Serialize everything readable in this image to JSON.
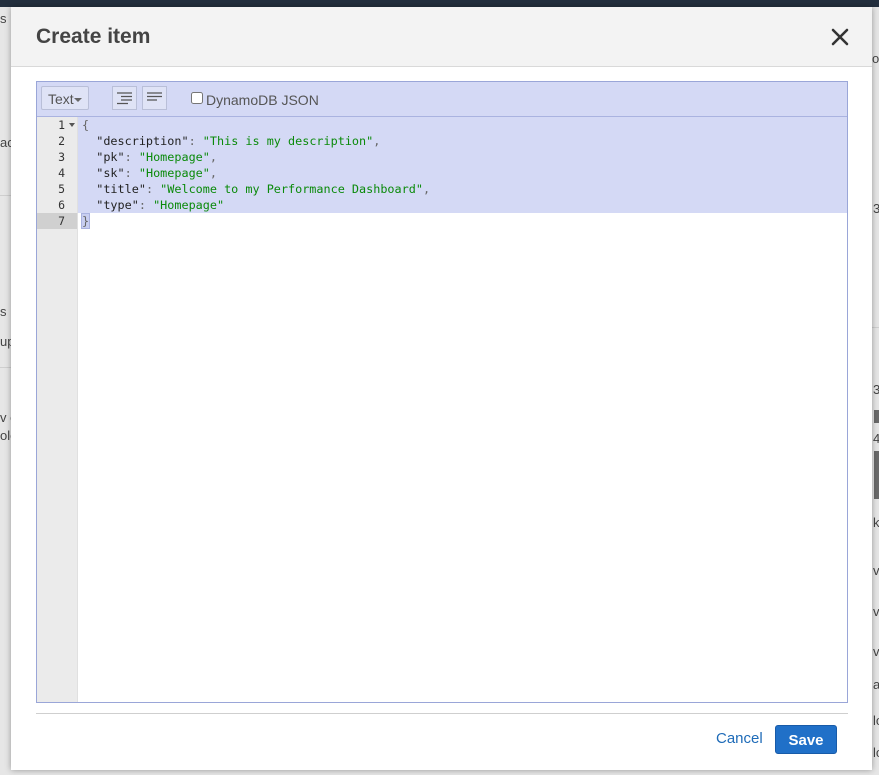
{
  "background": {
    "fragments": [
      "s",
      "o",
      "ac",
      "3",
      "s",
      "up",
      "3",
      "v c",
      "ole",
      "4",
      "k",
      "v",
      "v",
      "v",
      "a",
      "lo",
      "lo"
    ]
  },
  "modal": {
    "title": "Create item",
    "close_icon": "close-icon"
  },
  "editor": {
    "mode": "Text",
    "format_icon": "format-code-icon",
    "compact_icon": "compact-code-icon",
    "dynamodb_json_label": "DynamoDB JSON",
    "dynamodb_json_checked": false,
    "line_numbers": [
      "1",
      "2",
      "3",
      "4",
      "5",
      "6",
      "7"
    ],
    "lines": {
      "l1": "{",
      "l2_key": "\"description\"",
      "l2_val": "\"This is my description\"",
      "l3_key": "\"pk\"",
      "l3_val": "\"Homepage\"",
      "l4_key": "\"sk\"",
      "l4_val": "\"Homepage\"",
      "l5_key": "\"title\"",
      "l5_val": "\"Welcome to my Performance Dashboard\"",
      "l6_key": "\"type\"",
      "l6_val": "\"Homepage\"",
      "l7": "}"
    }
  },
  "footer": {
    "cancel_label": "Cancel",
    "save_label": "Save"
  },
  "colors": {
    "accent": "#2070c8",
    "selection": "#d4d9f5",
    "string": "#0a8a0a"
  }
}
